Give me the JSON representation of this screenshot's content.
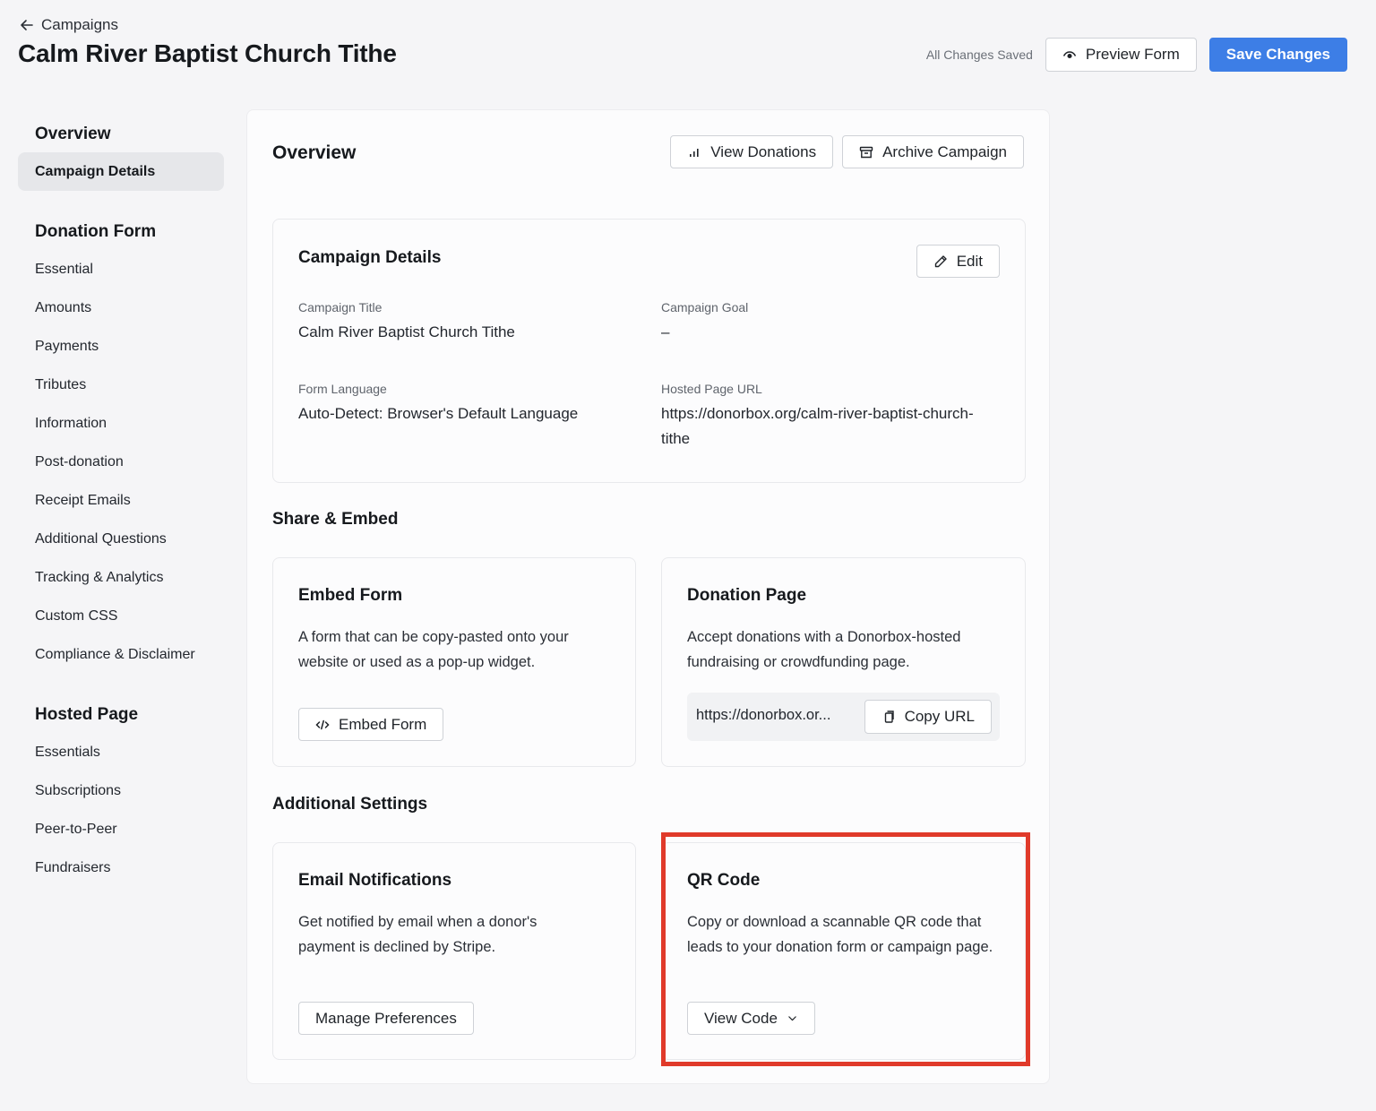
{
  "header": {
    "back_label": "Campaigns",
    "title": "Calm River Baptist Church Tithe",
    "saved_status": "All Changes Saved",
    "preview_label": "Preview Form",
    "save_label": "Save Changes"
  },
  "sidebar": {
    "sections": [
      {
        "heading": "Overview",
        "items": [
          "Campaign Details"
        ]
      },
      {
        "heading": "Donation Form",
        "items": [
          "Essential",
          "Amounts",
          "Payments",
          "Tributes",
          "Information",
          "Post-donation",
          "Receipt Emails",
          "Additional Questions",
          "Tracking & Analytics",
          "Custom CSS",
          "Compliance & Disclaimer"
        ]
      },
      {
        "heading": "Hosted Page",
        "items": [
          "Essentials",
          "Subscriptions",
          "Peer-to-Peer",
          "Fundraisers"
        ]
      }
    ],
    "active_item": "Campaign Details"
  },
  "overview": {
    "title": "Overview",
    "view_donations_label": "View Donations",
    "archive_label": "Archive Campaign"
  },
  "campaign_details": {
    "title": "Campaign Details",
    "edit_label": "Edit",
    "fields": {
      "campaign_title_label": "Campaign Title",
      "campaign_title_value": "Calm River Baptist Church Tithe",
      "campaign_goal_label": "Campaign Goal",
      "campaign_goal_value": "–",
      "form_language_label": "Form Language",
      "form_language_value": "Auto-Detect: Browser's Default Language",
      "hosted_url_label": "Hosted Page URL",
      "hosted_url_value_line1": "https://donorbox.org/calm-river-baptist-church-",
      "hosted_url_value_line2": "tithe"
    }
  },
  "share_embed": {
    "title": "Share & Embed",
    "embed_form": {
      "title": "Embed Form",
      "description": "A form that can be copy-pasted onto your website or used as a pop-up widget.",
      "button_label": "Embed Form"
    },
    "donation_page": {
      "title": "Donation Page",
      "description": "Accept donations with a Donorbox-hosted fundraising or crowdfunding page.",
      "url_preview": "https://donorbox.or...",
      "copy_label": "Copy URL"
    }
  },
  "additional_settings": {
    "title": "Additional Settings",
    "email_notifications": {
      "title": "Email Notifications",
      "description": "Get notified by email when a donor's payment is declined by Stripe.",
      "button_label": "Manage Preferences"
    },
    "qr_code": {
      "title": "QR Code",
      "description": "Copy or download a scannable QR code that leads to your donation form or campaign page.",
      "button_label": "View Code"
    }
  },
  "colors": {
    "primary": "#3d7ee6",
    "highlight": "#e03a2a",
    "background": "#f5f5f7"
  }
}
